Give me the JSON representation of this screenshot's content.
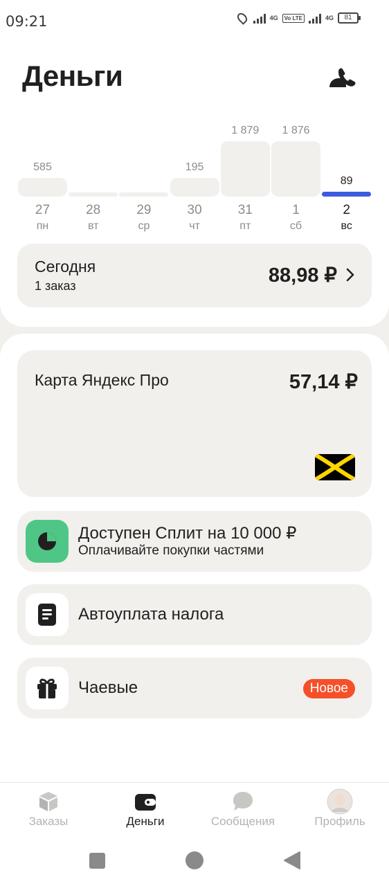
{
  "status_bar": {
    "time": "09:21",
    "net1": "4G",
    "volte": "Vo LTE",
    "net2": "4G",
    "battery": "81"
  },
  "header": {
    "title": "Деньги",
    "support_icon": "support-phone-icon"
  },
  "days": [
    {
      "num": "27",
      "name": "пн",
      "value": "585",
      "amount": 585
    },
    {
      "num": "28",
      "name": "вт",
      "value": "",
      "amount": 0
    },
    {
      "num": "29",
      "name": "ср",
      "value": "",
      "amount": 0
    },
    {
      "num": "30",
      "name": "чт",
      "value": "195",
      "amount": 195
    },
    {
      "num": "31",
      "name": "пт",
      "value": "1 879",
      "amount": 1879
    },
    {
      "num": "1",
      "name": "сб",
      "value": "1 876",
      "amount": 1876
    },
    {
      "num": "2",
      "name": "вс",
      "value": "89",
      "amount": 89,
      "selected": true
    }
  ],
  "today": {
    "title": "Сегодня",
    "orders": "1 заказ",
    "amount": "88,98 ₽"
  },
  "yandex_card": {
    "title": "Карта Яндекс Про",
    "amount": "57,14 ₽"
  },
  "split": {
    "title": "Доступен Сплит на 10 000 ₽",
    "subtitle": "Оплачивайте покупки частями"
  },
  "autotax": {
    "title": "Автоуплата налога"
  },
  "tips": {
    "title": "Чаевые",
    "badge": "Новое"
  },
  "bottom_nav": [
    {
      "label": "Заказы",
      "icon": "orders-box-icon"
    },
    {
      "label": "Деньги",
      "icon": "wallet-icon",
      "active": true
    },
    {
      "label": "Сообщения",
      "icon": "chat-bubble-icon"
    },
    {
      "label": "Профиль",
      "icon": "avatar"
    }
  ],
  "colors": {
    "accent": "#3c5cde",
    "badge": "#f5502a",
    "split_green": "#4fc685",
    "card_bg": "#f2f0ed"
  }
}
